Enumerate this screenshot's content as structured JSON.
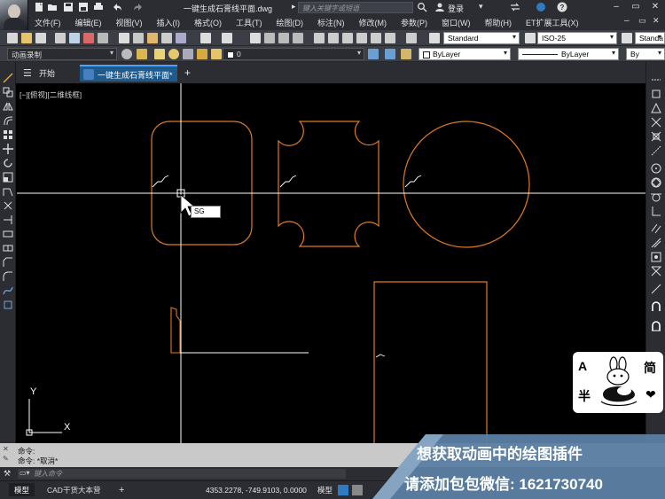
{
  "window": {
    "title": "一键生成石膏线平面.dwg",
    "search_placeholder": "键入关键字或短语",
    "login_label": "登录"
  },
  "menu": {
    "items": [
      "文件(F)",
      "编辑(E)",
      "视图(V)",
      "插入(I)",
      "格式(O)",
      "工具(T)",
      "绘图(D)",
      "标注(N)",
      "修改(M)",
      "参数(P)",
      "窗口(W)",
      "帮助(H)",
      "ET扩展工具(X)"
    ]
  },
  "toolbar1": {
    "text_style": "Standard",
    "dim_style": "ISO-25",
    "table_style": "Standa"
  },
  "toolbar2": {
    "workspace": "动画录制",
    "layer": "0",
    "color": "ByLayer",
    "linetype": "ByLayer",
    "lineweight": "By"
  },
  "tabs": {
    "start_label": "开始",
    "active_label": "一键生成石膏线平面*",
    "add_label": "+"
  },
  "viewport": {
    "label": "[−][俯视][二维线框]",
    "input_tip": "SG",
    "ucs_x": "X",
    "ucs_y": "Y"
  },
  "command": {
    "history": [
      "命令:",
      "命令: *取消*"
    ],
    "input_placeholder": "键入命令"
  },
  "status": {
    "layout_model": "模型",
    "layout_cad": "CAD干货大本营",
    "layout_add": "+",
    "coordinates": "4353.2278, -749.9103, 0.0000",
    "model_button": "模型"
  },
  "promo": {
    "line1": "想获取动画中的绘图插件",
    "line2": "请添加包包微信: 1621730740"
  },
  "sticker": {
    "chars": [
      "A",
      "简",
      "半",
      "❤"
    ]
  },
  "colors": {
    "drawing_orange": "#e07a1f",
    "crosshair": "#ffffff",
    "ui_dark": "#2b2d33",
    "toolbar": "#3b3e45",
    "active_tab": "#1e5a8c",
    "promo_blue": "#5b7fa3"
  }
}
